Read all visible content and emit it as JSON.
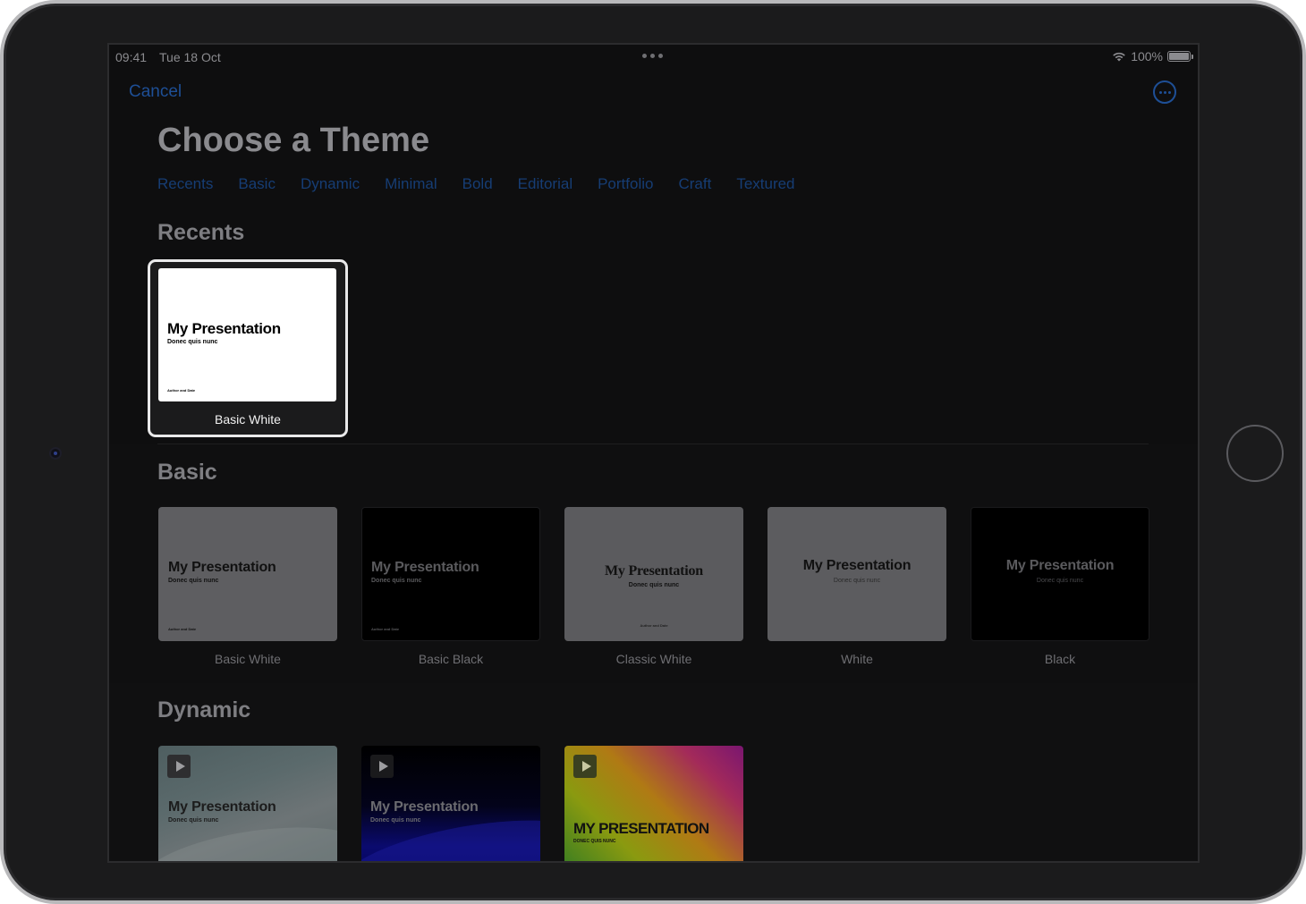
{
  "status_bar": {
    "time": "09:41",
    "date": "Tue 18 Oct",
    "battery": "100%"
  },
  "header": {
    "cancel_label": "Cancel",
    "title": "Choose a Theme"
  },
  "categories": [
    "Recents",
    "Basic",
    "Dynamic",
    "Minimal",
    "Bold",
    "Editorial",
    "Portfolio",
    "Craft",
    "Textured"
  ],
  "recents": {
    "title": "Recents",
    "selected": {
      "label": "Basic White",
      "slide_title": "My Presentation",
      "slide_subtitle": "Donec quis nunc",
      "slide_author": "Author and Date"
    }
  },
  "basic": {
    "title": "Basic",
    "themes": [
      {
        "label": "Basic White",
        "slide_title": "My Presentation",
        "slide_subtitle": "Donec quis nunc",
        "slide_author": "Author and Date"
      },
      {
        "label": "Basic Black",
        "slide_title": "My Presentation",
        "slide_subtitle": "Donec quis nunc",
        "slide_author": "Author and Date"
      },
      {
        "label": "Classic White",
        "slide_title": "My Presentation",
        "slide_subtitle": "Donec quis nunc",
        "slide_author": "Author and Date"
      },
      {
        "label": "White",
        "slide_title": "My Presentation",
        "slide_subtitle": "Donec quis nunc"
      },
      {
        "label": "Black",
        "slide_title": "My Presentation",
        "slide_subtitle": "Donec quis nunc"
      }
    ]
  },
  "dynamic": {
    "title": "Dynamic",
    "themes": [
      {
        "slide_title": "My Presentation",
        "slide_subtitle": "Donec quis nunc"
      },
      {
        "slide_title": "My Presentation",
        "slide_subtitle": "Donec quis nunc"
      },
      {
        "slide_title": "MY PRESENTATION",
        "slide_subtitle": "DONEC QUIS NUNC"
      }
    ]
  },
  "colors": {
    "accent": "#1e4f96",
    "background": "#0e0e0f",
    "selection_border": "#e9e9ea"
  }
}
